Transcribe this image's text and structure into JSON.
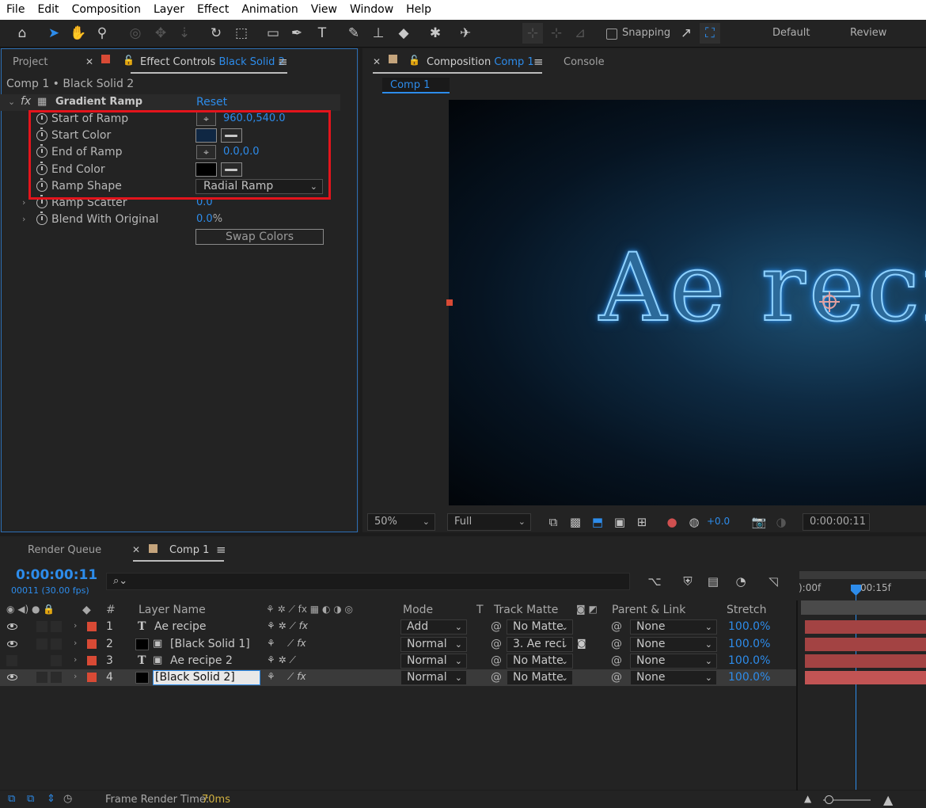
{
  "menu": [
    "File",
    "Edit",
    "Composition",
    "Layer",
    "Effect",
    "Animation",
    "View",
    "Window",
    "Help"
  ],
  "toolbar": {
    "snapping_label": "Snapping",
    "workspaces": [
      "Default",
      "Review"
    ],
    "tools": [
      "home-icon",
      "selection-icon",
      "hand-icon",
      "zoom-icon",
      "orbit-icon",
      "pan-icon",
      "dolly-icon",
      "rotate-icon",
      "pan-behind-icon",
      "rectangle-icon",
      "pen-icon",
      "type-icon",
      "brush-icon",
      "clone-stamp-icon",
      "eraser-icon",
      "roto-brush-icon",
      "puppet-pin-icon"
    ]
  },
  "left_panel": {
    "tab_project": "Project",
    "tab_effect_controls": "Effect Controls",
    "tab_effect_target": "Black Solid 2",
    "breadcrumb": "Comp 1 • Black Solid 2",
    "effect": {
      "fx": "fx",
      "name": "Gradient Ramp",
      "reset": "Reset",
      "properties": [
        {
          "name": "Start of Ramp",
          "value": "960.0,540.0",
          "control": "point"
        },
        {
          "name": "Start Color",
          "color": "#0f2743",
          "control": "color"
        },
        {
          "name": "End of Ramp",
          "value": "0.0,0.0",
          "control": "point"
        },
        {
          "name": "End Color",
          "color": "#000000",
          "control": "color"
        },
        {
          "name": "Ramp Shape",
          "value": "Radial Ramp",
          "control": "dropdown"
        },
        {
          "name": "Ramp Scatter",
          "value": "0.0",
          "control": "number"
        },
        {
          "name": "Blend With Original",
          "value": "0.0",
          "unit": "%",
          "control": "number"
        }
      ],
      "swap_button": "Swap Colors"
    }
  },
  "comp_panel": {
    "tab_composition": "Composition",
    "tab_comp_name": "Comp 1",
    "tab_console": "Console",
    "subtab": "Comp 1",
    "canvas_text": "Ae reci",
    "zoom": "50%",
    "resolution": "Full",
    "exposure": "+0.0",
    "timecode": "0:00:00:11"
  },
  "timeline": {
    "tab_render_queue": "Render Queue",
    "tab_comp": "Comp 1",
    "current_time": "0:00:00:11",
    "frame_fps": "00011 (30.00 fps)",
    "search_placeholder": "⌕⌄",
    "columns": {
      "num": "#",
      "layer_name": "Layer Name",
      "mode": "Mode",
      "t": "T",
      "track_matte": "Track Matte",
      "parent": "Parent & Link",
      "stretch": "Stretch"
    },
    "ruler": {
      "start": "):00f",
      "mark": "00:15f"
    },
    "layers": [
      {
        "num": "1",
        "type": "T",
        "name": "Ae recipe",
        "mode": "Add",
        "track_matte": "No Matte",
        "parent": "None",
        "stretch": "100.0%",
        "visible": true,
        "fx": true
      },
      {
        "num": "2",
        "type": "solid",
        "name": "[Black Solid 1]",
        "mode": "Normal",
        "track_matte": "3. Ae reci",
        "parent": "None",
        "stretch": "100.0%",
        "visible": true,
        "fx": true
      },
      {
        "num": "3",
        "type": "T",
        "name": "Ae recipe 2",
        "mode": "Normal",
        "track_matte": "No Matte",
        "parent": "None",
        "stretch": "100.0%",
        "visible": false,
        "fx": false
      },
      {
        "num": "4",
        "type": "solid",
        "name": "[Black Solid 2]",
        "mode": "Normal",
        "track_matte": "No Matte",
        "parent": "None",
        "stretch": "100.0%",
        "visible": true,
        "fx": true,
        "selected": true
      }
    ]
  },
  "status": {
    "frame_render_label": "Frame Render Time:",
    "frame_render_value": "70ms"
  }
}
